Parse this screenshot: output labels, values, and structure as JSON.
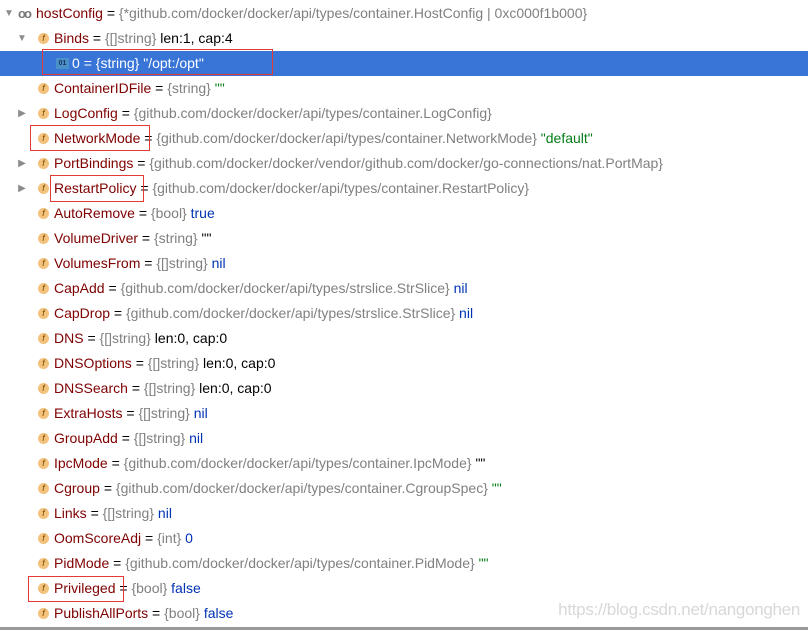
{
  "root": {
    "name": "hostConfig",
    "type": "{*github.com/docker/docker/api/types/container.HostConfig | 0xc000f1b000}",
    "icon": "watch-glasses-icon",
    "expanded": true
  },
  "rows": [
    {
      "name": "Binds",
      "type": "{[]string}",
      "value": "len:1, cap:4",
      "kind": "plain",
      "toggle": "expanded",
      "level": 1
    },
    {
      "name": "0",
      "type": "{string}",
      "value": "\"/opt:/opt\"",
      "kind": "string",
      "level": 2,
      "selected": true,
      "icon": "binary-icon"
    },
    {
      "name": "ContainerIDFile",
      "type": "{string}",
      "value": "\"\"",
      "kind": "string",
      "level": 1
    },
    {
      "name": "LogConfig",
      "type": "{github.com/docker/docker/api/types/container.LogConfig}",
      "value": "",
      "kind": "plain",
      "toggle": "collapsed",
      "level": 1
    },
    {
      "name": "NetworkMode",
      "type": "{github.com/docker/docker/api/types/container.NetworkMode}",
      "value": "\"default\"",
      "kind": "string",
      "level": 1
    },
    {
      "name": "PortBindings",
      "type": "{github.com/docker/docker/vendor/github.com/docker/go-connections/nat.PortMap}",
      "value": "",
      "kind": "plain",
      "toggle": "collapsed",
      "level": 1
    },
    {
      "name": "RestartPolicy",
      "type": "{github.com/docker/docker/api/types/container.RestartPolicy}",
      "value": "",
      "kind": "plain",
      "toggle": "collapsed",
      "level": 1
    },
    {
      "name": "AutoRemove",
      "type": "{bool}",
      "value": "true",
      "kind": "keyword",
      "level": 1
    },
    {
      "name": "VolumeDriver",
      "type": "{string}",
      "value": "\"\"",
      "kind": "plain",
      "level": 1
    },
    {
      "name": "VolumesFrom",
      "type": "{[]string}",
      "value": "nil",
      "kind": "keyword",
      "level": 1
    },
    {
      "name": "CapAdd",
      "type": "{github.com/docker/docker/api/types/strslice.StrSlice}",
      "value": "nil",
      "kind": "keyword",
      "level": 1
    },
    {
      "name": "CapDrop",
      "type": "{github.com/docker/docker/api/types/strslice.StrSlice}",
      "value": "nil",
      "kind": "keyword",
      "level": 1
    },
    {
      "name": "DNS",
      "type": "{[]string}",
      "value": "len:0, cap:0",
      "kind": "plain",
      "level": 1
    },
    {
      "name": "DNSOptions",
      "type": "{[]string}",
      "value": "len:0, cap:0",
      "kind": "plain",
      "level": 1
    },
    {
      "name": "DNSSearch",
      "type": "{[]string}",
      "value": "len:0, cap:0",
      "kind": "plain",
      "level": 1
    },
    {
      "name": "ExtraHosts",
      "type": "{[]string}",
      "value": "nil",
      "kind": "keyword",
      "level": 1
    },
    {
      "name": "GroupAdd",
      "type": "{[]string}",
      "value": "nil",
      "kind": "keyword",
      "level": 1
    },
    {
      "name": "IpcMode",
      "type": "{github.com/docker/docker/api/types/container.IpcMode}",
      "value": "\"\"",
      "kind": "plain",
      "level": 1
    },
    {
      "name": "Cgroup",
      "type": "{github.com/docker/docker/api/types/container.CgroupSpec}",
      "value": "\"\"",
      "kind": "string",
      "level": 1
    },
    {
      "name": "Links",
      "type": "{[]string}",
      "value": "nil",
      "kind": "keyword",
      "level": 1
    },
    {
      "name": "OomScoreAdj",
      "type": "{int}",
      "value": "0",
      "kind": "keyword",
      "level": 1
    },
    {
      "name": "PidMode",
      "type": "{github.com/docker/docker/api/types/container.PidMode}",
      "value": "\"\"",
      "kind": "string",
      "level": 1
    },
    {
      "name": "Privileged",
      "type": "{bool}",
      "value": "false",
      "kind": "keyword",
      "level": 1
    },
    {
      "name": "PublishAllPorts",
      "type": "{bool}",
      "value": "false",
      "kind": "keyword",
      "level": 1
    }
  ],
  "field_icon_glyph": "f",
  "binary_icon_glyph": "01",
  "equals": "=",
  "highlight_color": "#e53935",
  "selection_color": "#3875d7",
  "watermark": "https://blog.csdn.net/nangonghen"
}
